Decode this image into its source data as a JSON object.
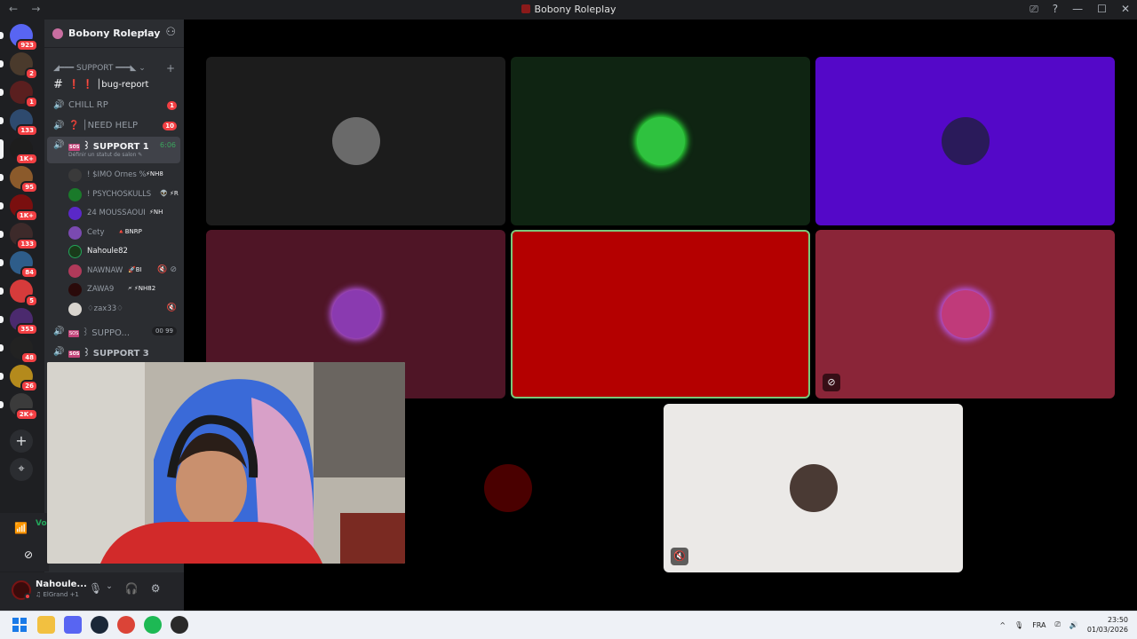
{
  "window": {
    "title": "Bobony Roleplay",
    "nav_back": "←",
    "nav_forward": "→",
    "controls": [
      "⎚",
      "?",
      "—",
      "☐",
      "✕"
    ]
  },
  "guilds": [
    {
      "badge": "923",
      "color": "#5865f2"
    },
    {
      "badge": "2",
      "color": "#4a3a2c"
    },
    {
      "badge": "1",
      "color": "#5a1f1f"
    },
    {
      "badge": "133",
      "color": "#2e4a6e"
    },
    {
      "badge": "1K+",
      "color": "#1d1d1d"
    },
    {
      "badge": "95",
      "color": "#8b5a2b"
    },
    {
      "badge": "1K+",
      "color": "#7a0f0f"
    },
    {
      "badge": "133",
      "color": "#3d2a2a"
    },
    {
      "badge": "84",
      "color": "#2e5d8a"
    },
    {
      "badge": "5",
      "color": "#d63b3b"
    },
    {
      "badge": "353",
      "color": "#4b2a6e"
    },
    {
      "badge": "48",
      "color": "#222222"
    },
    {
      "badge": "26",
      "color": "#b48a1c"
    },
    {
      "badge": "2K+",
      "color": "#3b3b3b"
    }
  ],
  "guild_actions": {
    "add": "+",
    "discover": "⌖"
  },
  "server": {
    "name": "Bobony Roleplay",
    "chevron": "⌄",
    "invite_icon": "⚇"
  },
  "category": {
    "label": "◢━━━ SUPPORT ━━━◣",
    "chevron": "⌄",
    "add": "+"
  },
  "channels": [
    {
      "icon": "#",
      "label": "❗ ❗ │bug-report",
      "count": ""
    },
    {
      "icon": "🔊",
      "label": "CHILL RP",
      "count": "1"
    },
    {
      "icon": "🔊",
      "label": "❓ │NEED HELP",
      "count": "10"
    }
  ],
  "active_channel": {
    "icon": "🔊",
    "sos": "SOS",
    "label": "꒱ SUPPORT 1",
    "time": "6:06",
    "status": "Définir un statut de salon ✎"
  },
  "voice_users": [
    {
      "name": "! $IMO Ornes %",
      "tag": "⚡NH8",
      "color": "#3a3a3a",
      "icons": ""
    },
    {
      "name": "! PSYCHOSKULLS",
      "tag": "👽 ⚡R",
      "color": "#1a7a2a",
      "icons": ""
    },
    {
      "name": "24 MOUSSAOUI",
      "tag": "⚡NH",
      "color": "#5a28c8",
      "icons": ""
    },
    {
      "name": "Cety",
      "tag": "🔺BNRP",
      "color": "#7a4ab0",
      "icons": ""
    },
    {
      "name": "Nahoule82",
      "tag": "",
      "color": "#1a3a1a",
      "icons": ""
    },
    {
      "name": "NAWNAW",
      "tag": "🚀BI",
      "color": "#b03a5a",
      "icons": "🔇 ⊘"
    },
    {
      "name": "ZAWA9",
      "tag": "🗲 ⚡NH82",
      "color": "#2a0a0a",
      "icons": ""
    },
    {
      "name": "♢zax33♢",
      "tag": "",
      "color": "#d8d4ce",
      "icons": "🔇"
    }
  ],
  "more_channels": [
    {
      "icon": "🔊",
      "sos": "SOS",
      "label": "꒱ SUPPO...",
      "counts": "00  99"
    },
    {
      "icon": "🔊",
      "sos": "SOS",
      "label": "꒱ SUPPORT 3",
      "counts": ""
    }
  ],
  "voice_panel": {
    "label": "Voi",
    "signal_icon": "📶",
    "video_off_icon": "⊘"
  },
  "user_panel": {
    "name": "Nahoule...",
    "sub": "♫ ElGrand +1",
    "mic_icon": "🎙",
    "headset_icon": "🎧",
    "settings_icon": "⚙",
    "chevron": "⌄"
  },
  "tiles": [
    {
      "bg": "#1c1c1c",
      "avatar": "#6a6a6a",
      "border": "",
      "mute": ""
    },
    {
      "bg": "#0f2412",
      "avatar": "#2fc23f",
      "border": "",
      "mute": ""
    },
    {
      "bg": "#5408c8",
      "avatar": "#2a1a5a",
      "border": "",
      "mute": ""
    },
    {
      "bg": "#4f1526",
      "avatar": "#8a3ab0",
      "border": "",
      "mute": ""
    },
    {
      "bg": "#b40000",
      "avatar": "#b40000",
      "border": "#7ac87a",
      "mute": ""
    },
    {
      "bg": "#8a2538",
      "avatar": "#c03a7a",
      "border": "",
      "mute": "⊘"
    },
    {
      "bg": "#000000",
      "avatar": "#4a0000",
      "border": "",
      "mute": ""
    },
    {
      "bg": "#ebe9e7",
      "avatar": "#4a3a34",
      "border": "",
      "mute": "🔇"
    }
  ],
  "taskbar": {
    "apps": [
      {
        "name": "windows",
        "color": "#1a7ae8"
      },
      {
        "name": "explorer",
        "color": "#f2c040"
      },
      {
        "name": "discord",
        "color": "#5865f2"
      },
      {
        "name": "steam",
        "color": "#1b2838"
      },
      {
        "name": "chrome",
        "color": "#db4437"
      },
      {
        "name": "spotify",
        "color": "#1db954"
      },
      {
        "name": "obs",
        "color": "#2a2a2a"
      }
    ],
    "tray": {
      "chevron": "^",
      "mic": "🎙",
      "lang": "FRA",
      "net": "⎚",
      "vol": "🔊"
    },
    "time": "23:50",
    "date": "01/03/2026"
  }
}
